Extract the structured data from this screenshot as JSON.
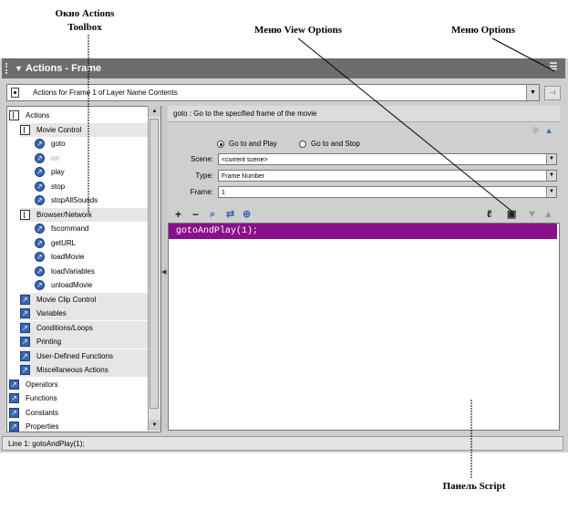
{
  "callouts": {
    "toolbox": "Окно Actions\nToolbox",
    "view_options": "Меню View Options",
    "options": "Меню Options",
    "script": "Панель Script"
  },
  "window": {
    "title": "Actions - Frame",
    "context": "Actions for Frame 1 of Layer Name Contents"
  },
  "toolbox": {
    "items": [
      {
        "label": "Actions",
        "icon": "book-icon",
        "level": 0
      },
      {
        "label": "Movie Control",
        "icon": "book-icon",
        "level": 1
      },
      {
        "label": "goto",
        "icon": "action-icon",
        "level": 2
      },
      {
        "label": "on",
        "icon": "action-icon",
        "level": 2,
        "dim": true
      },
      {
        "label": "play",
        "icon": "action-icon",
        "level": 2
      },
      {
        "label": "stop",
        "icon": "action-icon",
        "level": 2
      },
      {
        "label": "stopAllSounds",
        "icon": "action-icon",
        "level": 2
      },
      {
        "label": "Browser/Network",
        "icon": "book-icon",
        "level": 1
      },
      {
        "label": "fscommand",
        "icon": "action-icon",
        "level": 2
      },
      {
        "label": "getURL",
        "icon": "action-icon",
        "level": 2
      },
      {
        "label": "loadMovie",
        "icon": "action-icon",
        "level": 2
      },
      {
        "label": "loadVariables",
        "icon": "action-icon",
        "level": 2
      },
      {
        "label": "unloadMovie",
        "icon": "action-icon",
        "level": 2
      },
      {
        "label": "Movie Clip Control",
        "icon": "category-icon",
        "level": 1
      },
      {
        "label": "Variables",
        "icon": "category-icon",
        "level": 1
      },
      {
        "label": "Conditions/Loops",
        "icon": "category-icon",
        "level": 1
      },
      {
        "label": "Printing",
        "icon": "category-icon",
        "level": 1
      },
      {
        "label": "User-Defined Functions",
        "icon": "category-icon",
        "level": 1
      },
      {
        "label": "Miscellaneous Actions",
        "icon": "category-icon",
        "level": 1
      },
      {
        "label": "Operators",
        "icon": "category-icon",
        "level": 0
      },
      {
        "label": "Functions",
        "icon": "category-icon",
        "level": 0
      },
      {
        "label": "Constants",
        "icon": "category-icon",
        "level": 0
      },
      {
        "label": "Properties",
        "icon": "category-icon",
        "level": 0
      }
    ]
  },
  "description": "goto : Go to the specified frame of the movie",
  "params": {
    "radio_play": "Go to and Play",
    "radio_stop": "Go to and Stop",
    "scene_label": "Scene:",
    "scene_value": "<current scene>",
    "type_label": "Type:",
    "type_value": "Frame Number",
    "frame_label": "Frame:",
    "frame_value": "1"
  },
  "script": {
    "line1": "gotoAndPlay(1);"
  },
  "status": "Line 1: gotoAndPlay(1);",
  "colors": {
    "highlight": "#8a0f8a",
    "titlebar": "#6d6d6d"
  }
}
